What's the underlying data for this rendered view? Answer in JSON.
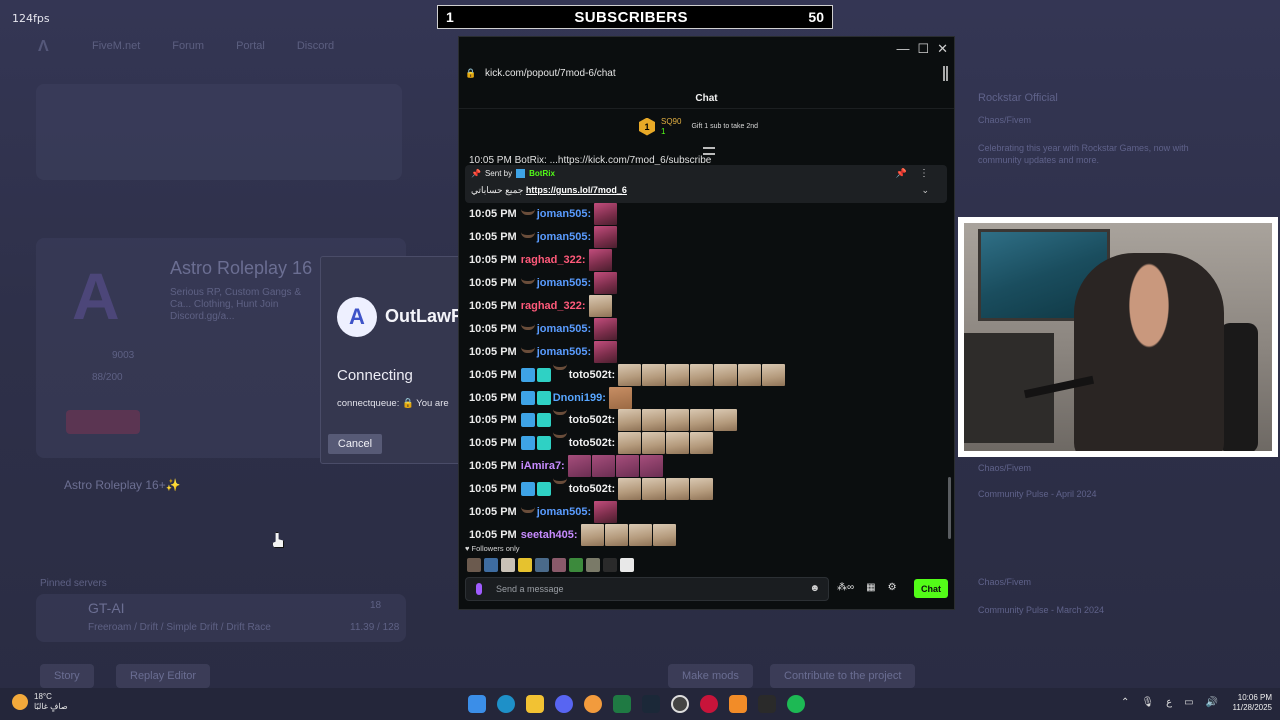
{
  "overlay": {
    "fps": "124fps"
  },
  "subscriber_bar": {
    "left": "1",
    "label": "SUBSCRIBERS",
    "right": "50"
  },
  "background": {
    "nav": [
      "FiveM.net",
      "Forum",
      "Portal",
      "Discord"
    ],
    "server_title": "Astro Roleplay 16",
    "server_desc": "Serious RP, Custom Gangs & Ca... Clothing, Hunt Join Discord.gg/a...",
    "players": "9003",
    "slots": "88/200",
    "section_label": "Astro Roleplay 16+✨",
    "pinned_title": "Pinned servers",
    "server2": "GT-AI",
    "server2_desc": "Freeroam / Drift / Simple Drift / Drift Race",
    "server2_players": "18",
    "server2_slots": "11.39 / 128",
    "btn1": "Story",
    "btn2": "Replay Editor",
    "btn3": "Make mods",
    "btn4": "Contribute to the project",
    "news_header": "Rockstar Official",
    "news": [
      {
        "author": "Chaos/Fivem",
        "text": "Celebrating this year with Rockstar Games, now with community updates and more."
      },
      {
        "author": "Chaos/Fivem",
        "text": "Community Pulse - April 2024"
      },
      {
        "author": "Chaos/Fivem",
        "text": "Community Pulse - March 2024"
      }
    ]
  },
  "dialog": {
    "brand": "OutLawR",
    "status": "Connecting",
    "queue_text": "connectqueue: 🔒 You are",
    "cancel_label": "Cancel"
  },
  "kick": {
    "url": "kick.com/popout/7mod-6/chat",
    "header": "Chat",
    "gift": {
      "rank": "1",
      "user": "SQ90",
      "count": "1",
      "text": "Gift 1 sub to take 2nd"
    },
    "truncated_line": "10:05 PM BotRix: ...https://kick.com/7mod_6/subscribe",
    "pinned": {
      "sent_by": "Sent by",
      "bot": "BotRix",
      "arabic": "جميع حساباتي",
      "link": "https://guns.lol/7mod_6"
    },
    "messages": [
      {
        "time": "10:05 PM",
        "user": "joman505:",
        "color": "u-blue",
        "badges": [
          "mous"
        ],
        "emotes": [
          "pink"
        ]
      },
      {
        "time": "10:05 PM",
        "user": "joman505:",
        "color": "u-blue",
        "badges": [
          "mous"
        ],
        "emotes": [
          "pink"
        ]
      },
      {
        "time": "10:05 PM",
        "user": "raghad_322:",
        "color": "u-red",
        "badges": [],
        "emotes": [
          "pink"
        ]
      },
      {
        "time": "10:05 PM",
        "user": "joman505:",
        "color": "u-blue",
        "badges": [
          "mous"
        ],
        "emotes": [
          "pink"
        ]
      },
      {
        "time": "10:05 PM",
        "user": "raghad_322:",
        "color": "u-red",
        "badges": [],
        "emotes": [
          "beige"
        ]
      },
      {
        "time": "10:05 PM",
        "user": "joman505:",
        "color": "u-blue",
        "badges": [
          "mous"
        ],
        "emotes": [
          "pink"
        ]
      },
      {
        "time": "10:05 PM",
        "user": "joman505:",
        "color": "u-blue",
        "badges": [
          "mous"
        ],
        "emotes": [
          "pink"
        ]
      },
      {
        "time": "10:05 PM",
        "user": "toto502t:",
        "color": "u-white",
        "badges": [
          "blue",
          "teal",
          "mous"
        ],
        "emotes": [
          "beige",
          "beige",
          "beige",
          "beige",
          "beige",
          "beige",
          "beige"
        ]
      },
      {
        "time": "10:05 PM",
        "user": "Dnoni199:",
        "color": "u-blue2",
        "badges": [
          "blue",
          "teal"
        ],
        "emotes": [
          "tan"
        ]
      },
      {
        "time": "10:05 PM",
        "user": "toto502t:",
        "color": "u-white",
        "badges": [
          "blue",
          "teal",
          "mous"
        ],
        "emotes": [
          "beige",
          "beige",
          "beige",
          "beige",
          "beige"
        ]
      },
      {
        "time": "10:05 PM",
        "user": "toto502t:",
        "color": "u-white",
        "badges": [
          "blue",
          "teal",
          "mous"
        ],
        "emotes": [
          "beige",
          "beige",
          "beige",
          "beige"
        ]
      },
      {
        "time": "10:05 PM",
        "user": "iAmira7:",
        "color": "u-pink",
        "badges": [],
        "emotes": [
          "purple",
          "purple",
          "purple",
          "purple"
        ]
      },
      {
        "time": "10:05 PM",
        "user": "toto502t:",
        "color": "u-white",
        "badges": [
          "blue",
          "teal",
          "mous"
        ],
        "emotes": [
          "beige",
          "beige",
          "beige",
          "beige"
        ]
      },
      {
        "time": "10:05 PM",
        "user": "joman505:",
        "color": "u-blue",
        "badges": [
          "mous"
        ],
        "emotes": [
          "pink"
        ]
      },
      {
        "time": "10:05 PM",
        "user": "seetah405:",
        "color": "u-pink",
        "badges": [],
        "emotes": [
          "beige",
          "beige",
          "beige",
          "beige"
        ]
      }
    ],
    "followers_only": "Followers only",
    "input_placeholder": "Send a message",
    "chat_button": "Chat"
  },
  "taskbar": {
    "temp": "18°C",
    "weather_text": "صافٍ غالبًا",
    "time": "10:06 PM",
    "date": "11/28/2025",
    "lang": "ع"
  },
  "colors": {
    "kick_green": "#53fc18",
    "chat_bg": "#0b0e0f",
    "launcher_bg": "#2b2d45"
  }
}
